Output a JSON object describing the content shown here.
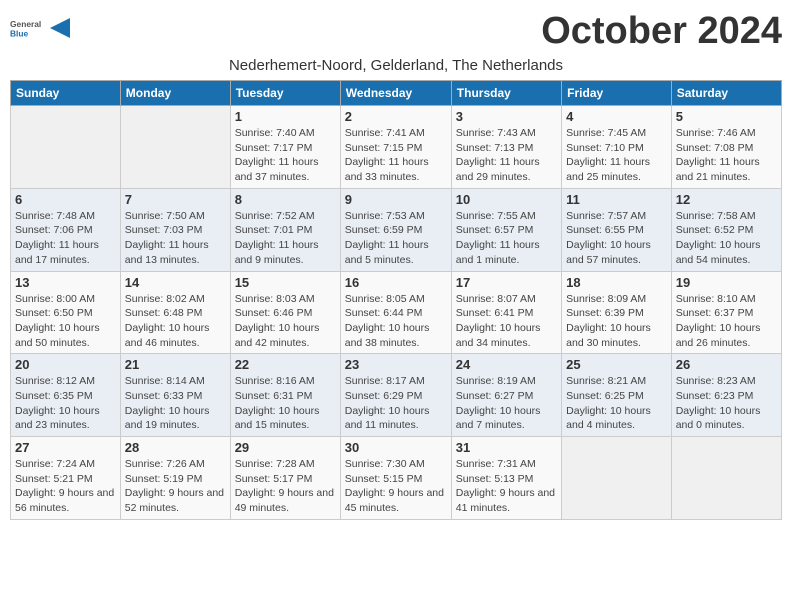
{
  "logo": {
    "general": "General",
    "blue": "Blue"
  },
  "title": "October 2024",
  "subtitle": "Nederhemert-Noord, Gelderland, The Netherlands",
  "days_of_week": [
    "Sunday",
    "Monday",
    "Tuesday",
    "Wednesday",
    "Thursday",
    "Friday",
    "Saturday"
  ],
  "weeks": [
    [
      {
        "day": "",
        "info": ""
      },
      {
        "day": "",
        "info": ""
      },
      {
        "day": "1",
        "info": "Sunrise: 7:40 AM\nSunset: 7:17 PM\nDaylight: 11 hours and 37 minutes."
      },
      {
        "day": "2",
        "info": "Sunrise: 7:41 AM\nSunset: 7:15 PM\nDaylight: 11 hours and 33 minutes."
      },
      {
        "day": "3",
        "info": "Sunrise: 7:43 AM\nSunset: 7:13 PM\nDaylight: 11 hours and 29 minutes."
      },
      {
        "day": "4",
        "info": "Sunrise: 7:45 AM\nSunset: 7:10 PM\nDaylight: 11 hours and 25 minutes."
      },
      {
        "day": "5",
        "info": "Sunrise: 7:46 AM\nSunset: 7:08 PM\nDaylight: 11 hours and 21 minutes."
      }
    ],
    [
      {
        "day": "6",
        "info": "Sunrise: 7:48 AM\nSunset: 7:06 PM\nDaylight: 11 hours and 17 minutes."
      },
      {
        "day": "7",
        "info": "Sunrise: 7:50 AM\nSunset: 7:03 PM\nDaylight: 11 hours and 13 minutes."
      },
      {
        "day": "8",
        "info": "Sunrise: 7:52 AM\nSunset: 7:01 PM\nDaylight: 11 hours and 9 minutes."
      },
      {
        "day": "9",
        "info": "Sunrise: 7:53 AM\nSunset: 6:59 PM\nDaylight: 11 hours and 5 minutes."
      },
      {
        "day": "10",
        "info": "Sunrise: 7:55 AM\nSunset: 6:57 PM\nDaylight: 11 hours and 1 minute."
      },
      {
        "day": "11",
        "info": "Sunrise: 7:57 AM\nSunset: 6:55 PM\nDaylight: 10 hours and 57 minutes."
      },
      {
        "day": "12",
        "info": "Sunrise: 7:58 AM\nSunset: 6:52 PM\nDaylight: 10 hours and 54 minutes."
      }
    ],
    [
      {
        "day": "13",
        "info": "Sunrise: 8:00 AM\nSunset: 6:50 PM\nDaylight: 10 hours and 50 minutes."
      },
      {
        "day": "14",
        "info": "Sunrise: 8:02 AM\nSunset: 6:48 PM\nDaylight: 10 hours and 46 minutes."
      },
      {
        "day": "15",
        "info": "Sunrise: 8:03 AM\nSunset: 6:46 PM\nDaylight: 10 hours and 42 minutes."
      },
      {
        "day": "16",
        "info": "Sunrise: 8:05 AM\nSunset: 6:44 PM\nDaylight: 10 hours and 38 minutes."
      },
      {
        "day": "17",
        "info": "Sunrise: 8:07 AM\nSunset: 6:41 PM\nDaylight: 10 hours and 34 minutes."
      },
      {
        "day": "18",
        "info": "Sunrise: 8:09 AM\nSunset: 6:39 PM\nDaylight: 10 hours and 30 minutes."
      },
      {
        "day": "19",
        "info": "Sunrise: 8:10 AM\nSunset: 6:37 PM\nDaylight: 10 hours and 26 minutes."
      }
    ],
    [
      {
        "day": "20",
        "info": "Sunrise: 8:12 AM\nSunset: 6:35 PM\nDaylight: 10 hours and 23 minutes."
      },
      {
        "day": "21",
        "info": "Sunrise: 8:14 AM\nSunset: 6:33 PM\nDaylight: 10 hours and 19 minutes."
      },
      {
        "day": "22",
        "info": "Sunrise: 8:16 AM\nSunset: 6:31 PM\nDaylight: 10 hours and 15 minutes."
      },
      {
        "day": "23",
        "info": "Sunrise: 8:17 AM\nSunset: 6:29 PM\nDaylight: 10 hours and 11 minutes."
      },
      {
        "day": "24",
        "info": "Sunrise: 8:19 AM\nSunset: 6:27 PM\nDaylight: 10 hours and 7 minutes."
      },
      {
        "day": "25",
        "info": "Sunrise: 8:21 AM\nSunset: 6:25 PM\nDaylight: 10 hours and 4 minutes."
      },
      {
        "day": "26",
        "info": "Sunrise: 8:23 AM\nSunset: 6:23 PM\nDaylight: 10 hours and 0 minutes."
      }
    ],
    [
      {
        "day": "27",
        "info": "Sunrise: 7:24 AM\nSunset: 5:21 PM\nDaylight: 9 hours and 56 minutes."
      },
      {
        "day": "28",
        "info": "Sunrise: 7:26 AM\nSunset: 5:19 PM\nDaylight: 9 hours and 52 minutes."
      },
      {
        "day": "29",
        "info": "Sunrise: 7:28 AM\nSunset: 5:17 PM\nDaylight: 9 hours and 49 minutes."
      },
      {
        "day": "30",
        "info": "Sunrise: 7:30 AM\nSunset: 5:15 PM\nDaylight: 9 hours and 45 minutes."
      },
      {
        "day": "31",
        "info": "Sunrise: 7:31 AM\nSunset: 5:13 PM\nDaylight: 9 hours and 41 minutes."
      },
      {
        "day": "",
        "info": ""
      },
      {
        "day": "",
        "info": ""
      }
    ]
  ]
}
